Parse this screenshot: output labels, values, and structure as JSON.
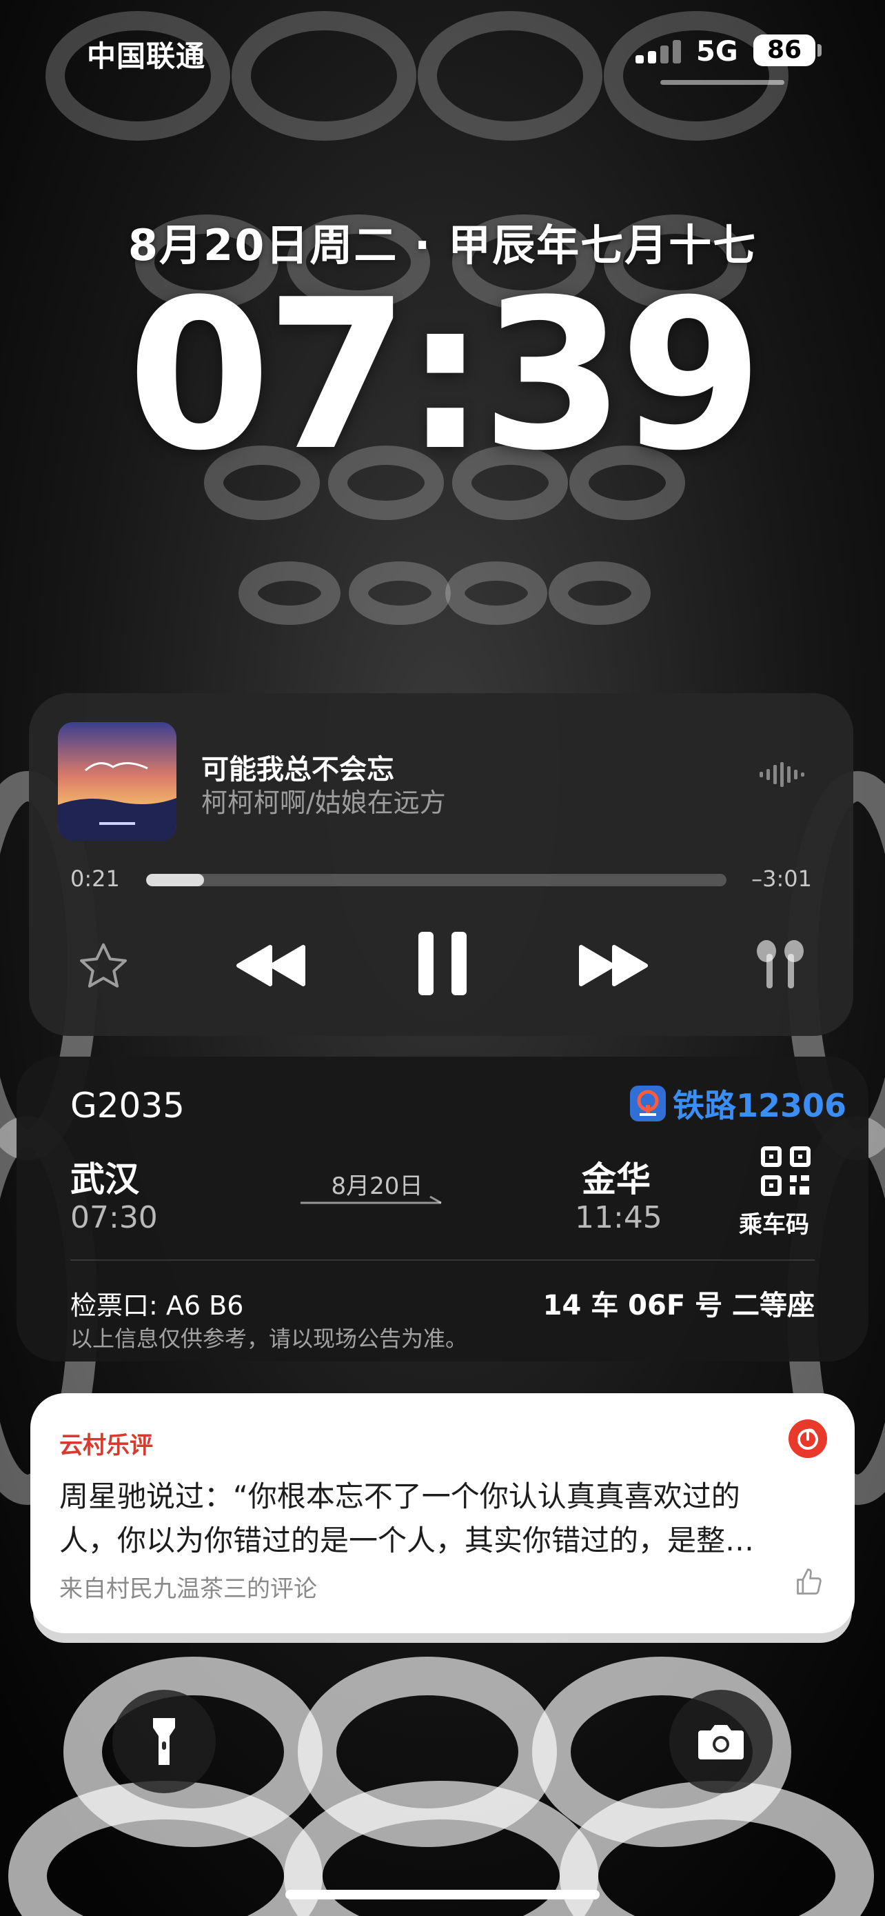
{
  "status_bar": {
    "carrier": "中国联通",
    "network": "5G",
    "battery": "86"
  },
  "lock_screen": {
    "date": "8月20日周二 · 甲辰年七月十七",
    "time": "07:39"
  },
  "now_playing": {
    "song_title": "可能我总不会忘",
    "artist_album": "柯柯柯啊/姑娘在远方",
    "elapsed": "0:21",
    "remaining": "–3:01",
    "progress": 0.1
  },
  "train_ticket": {
    "train_no": "G2035",
    "provider": "铁路12306",
    "from_city": "武汉",
    "from_time": "07:30",
    "date": "8月20日",
    "to_city": "金华",
    "to_time": "11:45",
    "qr_label": "乘车码",
    "gate": "检票口: A6 B6",
    "seat": "14 车 06F 号  二等座",
    "disclaimer": "以上信息仅供参考，请以现场公告为准。"
  },
  "notification": {
    "app": "云村乐评",
    "line1": "周星驰说过：“你根本忘不了一个你认认真真喜欢过的",
    "line2": "人，你以为你错过的是一个人，其实你错过的，是整…",
    "source": "来自村民九温茶三的评论"
  },
  "colors": {
    "accent_red": "#d83a2f",
    "rail_blue": "#3a8ef6"
  }
}
